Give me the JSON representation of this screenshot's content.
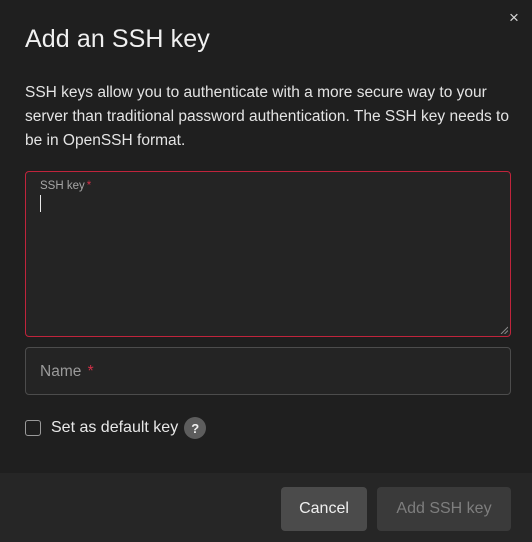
{
  "dialog": {
    "close_icon": "×",
    "title": "Add an SSH key",
    "description": "SSH keys allow you to authenticate with a more secure way to your server than traditional password authentication. The SSH key needs to be in OpenSSH format."
  },
  "ssh_key_field": {
    "label": "SSH key",
    "required_mark": "*",
    "value": "",
    "state": "focused-error",
    "border_color": "#c0243c"
  },
  "name_field": {
    "placeholder": "Name",
    "required_mark": "*",
    "value": ""
  },
  "default_key": {
    "label": "Set as default key",
    "checked": false,
    "help_icon": "?"
  },
  "footer": {
    "cancel_label": "Cancel",
    "add_label": "Add SSH key",
    "add_enabled": false
  },
  "colors": {
    "background": "#1f1f1f",
    "error_accent": "#c0243c",
    "required_mark": "#d23048"
  }
}
